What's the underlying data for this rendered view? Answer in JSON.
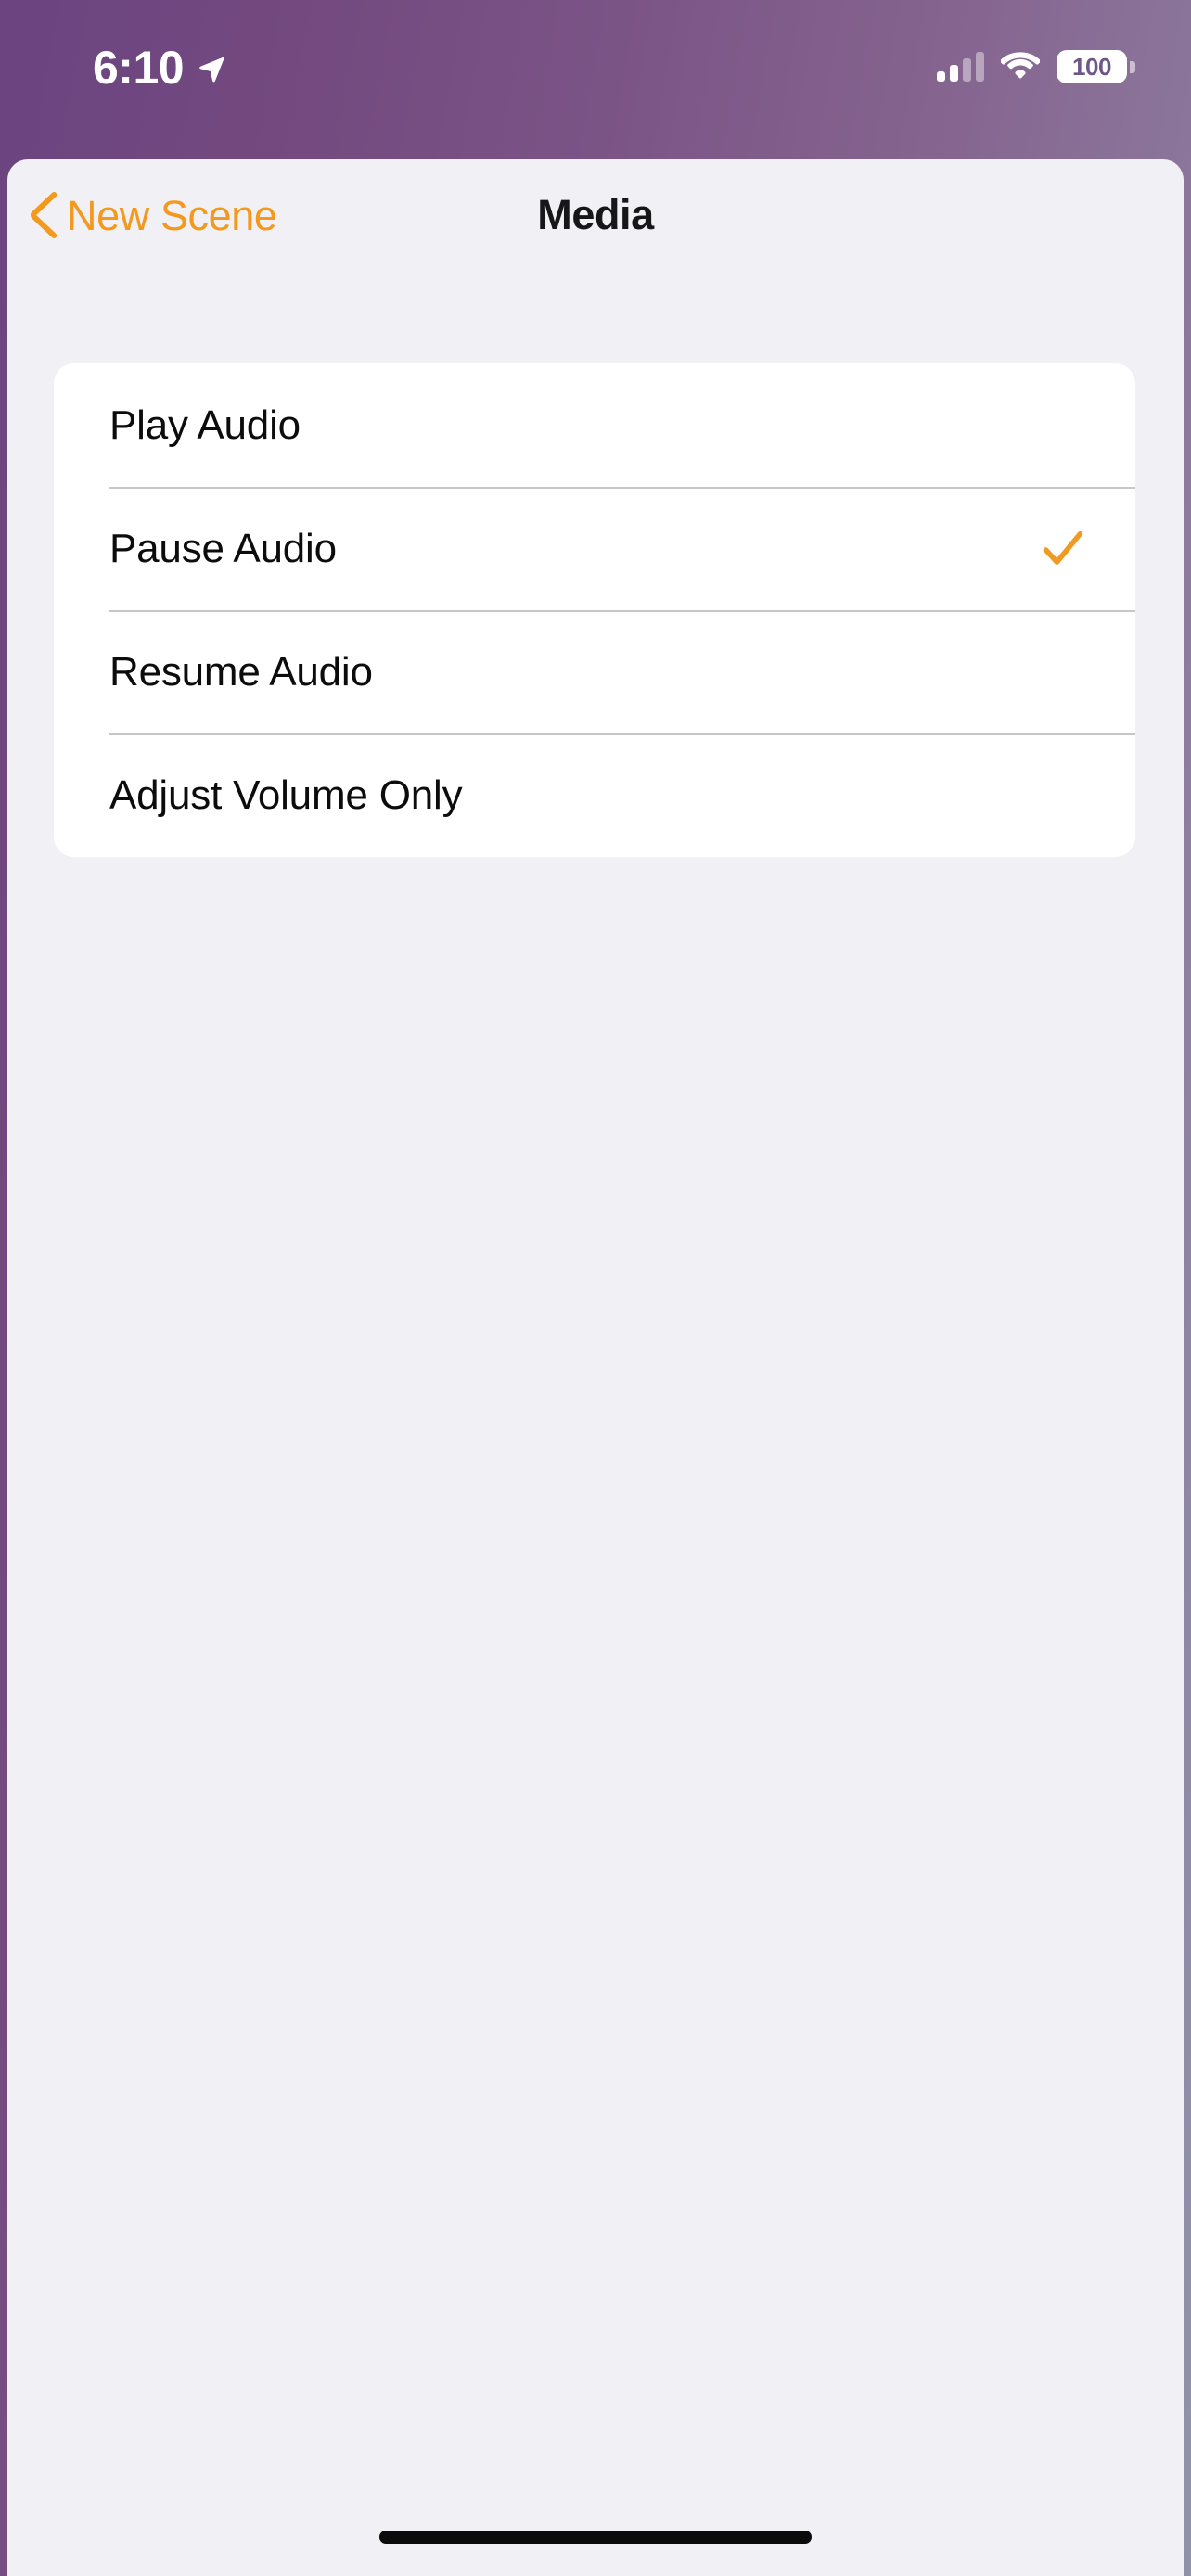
{
  "status_bar": {
    "time": "6:10",
    "location_icon": "location-arrow-icon",
    "cellular_icon": "cellular-bars-icon",
    "wifi_icon": "wifi-icon",
    "battery_icon": "battery-icon",
    "battery_percent": "100"
  },
  "nav": {
    "back_label": "New Scene",
    "back_icon": "chevron-left-icon",
    "title": "Media"
  },
  "options": {
    "selected": "Pause Audio",
    "items": [
      {
        "label": "Play Audio",
        "checked": false
      },
      {
        "label": "Pause Audio",
        "checked": true
      },
      {
        "label": "Resume Audio",
        "checked": false
      },
      {
        "label": "Adjust Volume Only",
        "checked": false
      }
    ]
  },
  "colors": {
    "accent": "#f2991e",
    "checkmark": "#ef9b23",
    "sheet_background": "#f1f1f5",
    "card_background": "#ffffff",
    "separator": "#c6c6c8",
    "title_text": "#17171a",
    "row_text": "#0c0c0d",
    "gradient_start": "#6b4480",
    "gradient_end": "#9093ac"
  },
  "home_indicator": "home-indicator"
}
